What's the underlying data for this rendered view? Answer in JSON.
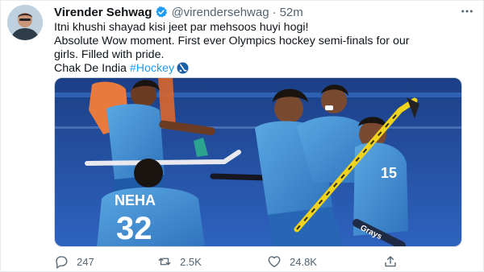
{
  "tweet": {
    "author_name": "Virender Sehwag",
    "handle": "@virendersehwag",
    "separator": "·",
    "time": "52m",
    "lines": [
      "Itni khushi shayad kisi jeet par mehsoos huyi hogi!",
      "Absolute Wow moment. First ever Olympics  hockey semi-finals for our",
      "girls. Filled with pride.",
      "Chak De India "
    ],
    "hashtag": "#Hockey",
    "photo_text": {
      "jersey_name": "NEHA",
      "jersey_number": "32",
      "number_15": "15",
      "stick_brand": "Grays"
    }
  },
  "actions": {
    "replies": "247",
    "retweets": "2.5K",
    "likes": "24.8K"
  },
  "colors": {
    "accent": "#1d9bf0",
    "muted": "#536471",
    "turf": "#2b5fb8",
    "jersey": "#4f9bd8"
  },
  "icons": [
    "avatar",
    "verified-badge-icon",
    "more-icon",
    "hockey-emoji-icon",
    "reply-icon",
    "retweet-icon",
    "like-icon",
    "share-icon"
  ]
}
